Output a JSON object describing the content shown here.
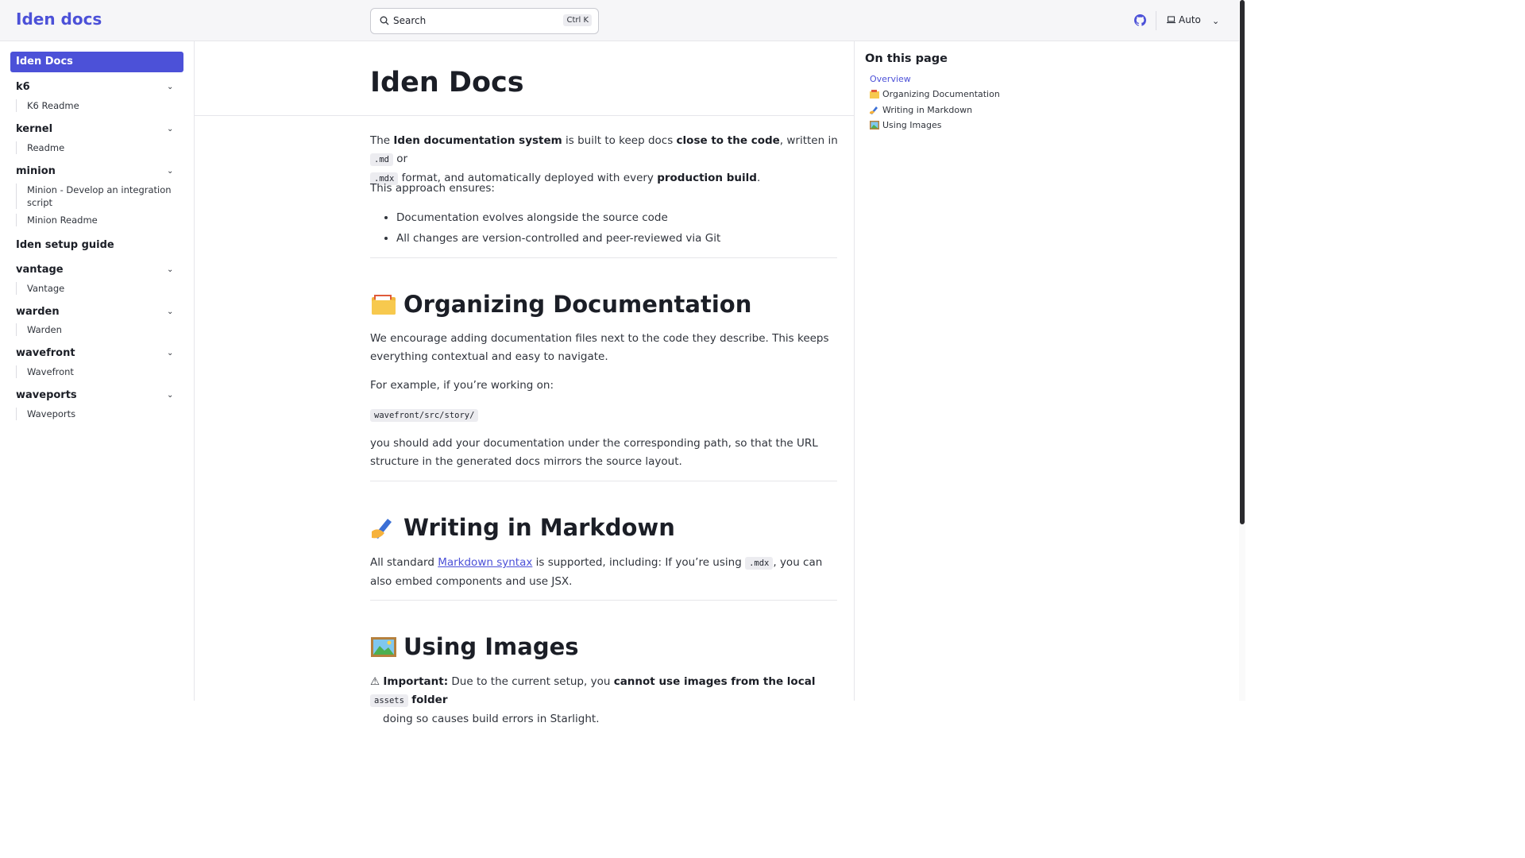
{
  "header": {
    "site_title": "Iden docs",
    "search_placeholder": "Search",
    "search_shortcut": "Ctrl K",
    "github_icon": "github-icon",
    "theme_label": "Auto"
  },
  "sidebar": {
    "active": "Iden Docs",
    "groups": [
      {
        "label": "k6",
        "items": [
          "K6 Readme"
        ]
      },
      {
        "label": "kernel",
        "items": [
          "Readme"
        ]
      },
      {
        "label": "minion",
        "items": [
          "Minion - Develop an integration script",
          "Minion Readme"
        ]
      },
      {
        "label": "Iden setup guide",
        "items": []
      },
      {
        "label": "vantage",
        "items": [
          "Vantage"
        ]
      },
      {
        "label": "warden",
        "items": [
          "Warden"
        ]
      },
      {
        "label": "wavefront",
        "items": [
          "Wavefront"
        ]
      },
      {
        "label": "waveports",
        "items": [
          "Waveports"
        ]
      }
    ]
  },
  "main": {
    "title": "Iden Docs",
    "intro": {
      "p1_a": "The ",
      "p1_b": "Iden documentation system",
      "p1_c": " is built to keep docs ",
      "p1_d": "close to the code",
      "p1_e": ", written in ",
      "code_md": ".md",
      "p1_f": " or",
      "code_mdx": ".mdx",
      "p1_g": " format, and automatically deployed with every ",
      "p1_h": "production build",
      "p1_i": ".",
      "p2": "This approach ensures:",
      "bullets": [
        "Documentation evolves alongside the source code",
        "All changes are version-controlled and peer-reviewed via Git"
      ]
    },
    "organizing": {
      "heading": "Organizing Documentation",
      "p1": "We encourage adding documentation files next to the code they describe. This keeps everything contextual and easy to navigate.",
      "p2": "For example, if you’re working on:",
      "code": "wavefront/src/story/",
      "p3": "you should add your documentation under the corresponding path, so that the URL structure in the generated docs mirrors the source layout."
    },
    "writing": {
      "heading": "Writing in Markdown",
      "a": "All standard ",
      "link": "Markdown syntax",
      "b": " is supported, including: If you’re using ",
      "code": ".mdx",
      "c": ", you can also embed components and use JSX."
    },
    "images": {
      "heading": "Using Images",
      "warn_icon": "⚠",
      "label": "Important:",
      "a": " Due to the current setup, you ",
      "b": "cannot use images from the local",
      "code": "assets",
      "c": "folder",
      "d": "doing so causes build errors in Starlight."
    }
  },
  "toc": {
    "title": "On this page",
    "items": [
      "Overview",
      "Organizing Documentation",
      "Writing in Markdown",
      "Using Images"
    ]
  },
  "colors": {
    "accent": "#4c51d8",
    "text": "#30343c",
    "heading": "#1b1e26",
    "border": "#e6e6ea"
  }
}
